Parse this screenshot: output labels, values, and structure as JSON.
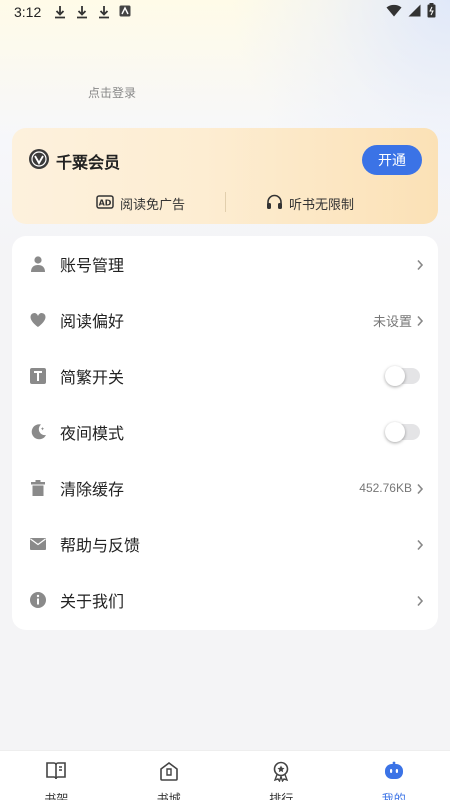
{
  "status_bar": {
    "time": "3:12"
  },
  "profile": {
    "login_text": "点击登录"
  },
  "vip": {
    "title": "千粟会员",
    "button_label": "开通",
    "perks": [
      "阅读免广告",
      "听书无限制"
    ]
  },
  "menu": {
    "items": [
      {
        "label": "账号管理",
        "value": "",
        "control": "chevron",
        "icon": "person-icon"
      },
      {
        "label": "阅读偏好",
        "value": "未设置",
        "control": "chevron",
        "icon": "heart-icon"
      },
      {
        "label": "简繁开关",
        "value": "",
        "control": "toggle",
        "toggle_on": false,
        "icon": "text-t-icon"
      },
      {
        "label": "夜间模式",
        "value": "",
        "control": "toggle",
        "toggle_on": false,
        "icon": "moon-icon"
      },
      {
        "label": "清除缓存",
        "value": "452.76KB",
        "control": "chevron",
        "icon": "trash-icon"
      },
      {
        "label": "帮助与反馈",
        "value": "",
        "control": "chevron",
        "icon": "envelope-icon"
      },
      {
        "label": "关于我们",
        "value": "",
        "control": "chevron",
        "icon": "info-icon"
      }
    ]
  },
  "tabs": [
    {
      "label": "书架",
      "icon": "book-icon",
      "active": false
    },
    {
      "label": "书城",
      "icon": "store-icon",
      "active": false
    },
    {
      "label": "排行",
      "icon": "ranking-icon",
      "active": false
    },
    {
      "label": "我的",
      "icon": "robot-face-icon",
      "active": true
    }
  ],
  "colors": {
    "accent": "#3b73e6",
    "vip_gradient_start": "#fdf1dd",
    "vip_gradient_end": "#fbe1b6"
  }
}
